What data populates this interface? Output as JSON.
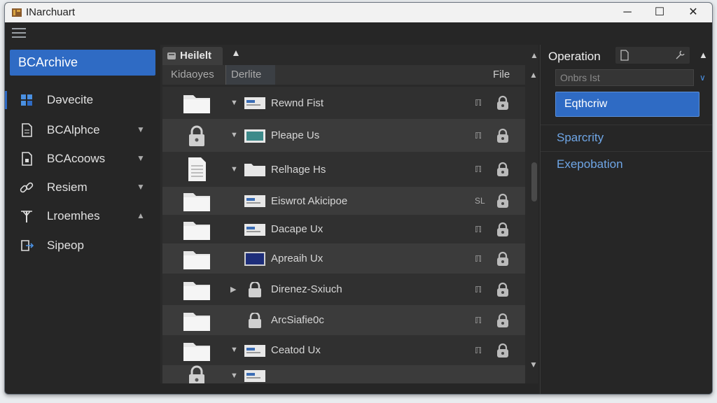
{
  "window": {
    "title": "INarchuart",
    "minimize": "─",
    "maximize": "☐",
    "close": "✕"
  },
  "sidebar": {
    "active_label": "BCArchive",
    "items": [
      {
        "label": "Dəvecite",
        "icon": "cube-icon",
        "chevron": ""
      },
      {
        "label": "BCAlphce",
        "icon": "document-icon",
        "chevron": "▼"
      },
      {
        "label": "BCAcoows",
        "icon": "document-lock-icon",
        "chevron": "▼"
      },
      {
        "label": "Resiem",
        "icon": "link-icon",
        "chevron": "▼"
      },
      {
        "label": "Lroemhes",
        "icon": "tree-icon",
        "chevron": "▲"
      },
      {
        "label": "Sipeop",
        "icon": "export-icon",
        "chevron": ""
      }
    ]
  },
  "center": {
    "tab_label": "Heilelt",
    "columns": [
      "Kidaoyes",
      "Derlite",
      "File"
    ],
    "rows": [
      {
        "lead": "folder",
        "arrow": "▼",
        "small": "drive",
        "name": "Rewnd Fist",
        "mark": "ℿ"
      },
      {
        "lead": "lock",
        "arrow": "▼",
        "small": "image",
        "name": "Pleape Us",
        "mark": "ℿ"
      },
      {
        "lead": "document",
        "arrow": "▼",
        "small": "folder",
        "name": "Relhage Hs",
        "mark": "ℿ"
      },
      {
        "lead": "folder",
        "arrow": "",
        "small": "drive",
        "name": "Eiswrot Akicipoe",
        "mark": "SL"
      },
      {
        "lead": "folder",
        "arrow": "",
        "small": "drive",
        "name": "Dacape Ux",
        "mark": "ℿ"
      },
      {
        "lead": "folder",
        "arrow": "",
        "small": "monitor",
        "name": "Apreaih Ux",
        "mark": "ℿ"
      },
      {
        "lead": "folder",
        "arrow": "▶",
        "small": "lock",
        "name": "Direnez-Sxiuch",
        "mark": "ℿ"
      },
      {
        "lead": "folder",
        "arrow": "",
        "small": "lock",
        "name": "ArcSiafie0c",
        "mark": "ℿ"
      },
      {
        "lead": "folder",
        "arrow": "▼",
        "small": "drive",
        "name": "Ceatod Ux",
        "mark": "ℿ"
      },
      {
        "lead": "lock",
        "arrow": "▼",
        "small": "drive",
        "name": "",
        "mark": ""
      }
    ]
  },
  "right": {
    "title": "Operation",
    "filter_placeholder": "Onbrs Ist",
    "primary_button": "Eqthcriw",
    "links": [
      "Sparcrity",
      "Exepobation"
    ]
  },
  "colors": {
    "accent": "#2f6bc4",
    "link": "#6fa6e6",
    "background": "#262626"
  }
}
